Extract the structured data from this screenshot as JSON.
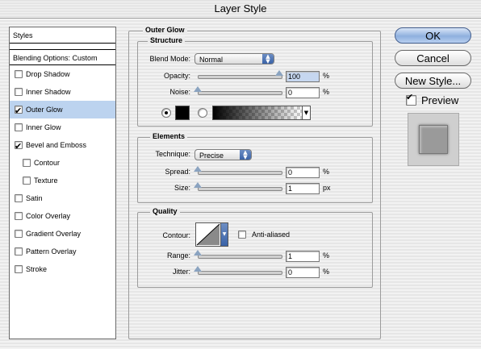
{
  "window": {
    "title": "Layer Style"
  },
  "styles_list": {
    "header": "Styles",
    "blending_options": "Blending Options: Custom",
    "items": [
      {
        "label": "Drop Shadow",
        "checked": false,
        "selected": false,
        "indent": false
      },
      {
        "label": "Inner Shadow",
        "checked": false,
        "selected": false,
        "indent": false
      },
      {
        "label": "Outer Glow",
        "checked": true,
        "selected": true,
        "indent": false
      },
      {
        "label": "Inner Glow",
        "checked": false,
        "selected": false,
        "indent": false
      },
      {
        "label": "Bevel and Emboss",
        "checked": true,
        "selected": false,
        "indent": false
      },
      {
        "label": "Contour",
        "checked": false,
        "selected": false,
        "indent": true
      },
      {
        "label": "Texture",
        "checked": false,
        "selected": false,
        "indent": true
      },
      {
        "label": "Satin",
        "checked": false,
        "selected": false,
        "indent": false
      },
      {
        "label": "Color Overlay",
        "checked": false,
        "selected": false,
        "indent": false
      },
      {
        "label": "Gradient Overlay",
        "checked": false,
        "selected": false,
        "indent": false
      },
      {
        "label": "Pattern Overlay",
        "checked": false,
        "selected": false,
        "indent": false
      },
      {
        "label": "Stroke",
        "checked": false,
        "selected": false,
        "indent": false
      }
    ]
  },
  "panel": {
    "title": "Outer Glow",
    "structure": {
      "title": "Structure",
      "blend_mode_label": "Blend Mode:",
      "blend_mode_value": "Normal",
      "opacity_label": "Opacity:",
      "opacity_value": "100",
      "opacity_unit": "%",
      "opacity_level": 1.0,
      "noise_label": "Noise:",
      "noise_value": "0",
      "noise_unit": "%",
      "noise_level": 0.0,
      "glow_color": "#000000"
    },
    "elements": {
      "title": "Elements",
      "technique_label": "Technique:",
      "technique_value": "Precise",
      "spread_label": "Spread:",
      "spread_value": "0",
      "spread_unit": "%",
      "spread_level": 0.0,
      "size_label": "Size:",
      "size_value": "1",
      "size_unit": "px",
      "size_level": 0.0
    },
    "quality": {
      "title": "Quality",
      "contour_label": "Contour:",
      "anti_aliased_label": "Anti-aliased",
      "anti_aliased_checked": false,
      "range_label": "Range:",
      "range_value": "1",
      "range_unit": "%",
      "range_level": 0.0,
      "jitter_label": "Jitter:",
      "jitter_value": "0",
      "jitter_unit": "%",
      "jitter_level": 0.0
    }
  },
  "buttons": {
    "ok": "OK",
    "cancel": "Cancel",
    "new_style": "New Style...",
    "preview_label": "Preview",
    "preview_checked": true
  }
}
